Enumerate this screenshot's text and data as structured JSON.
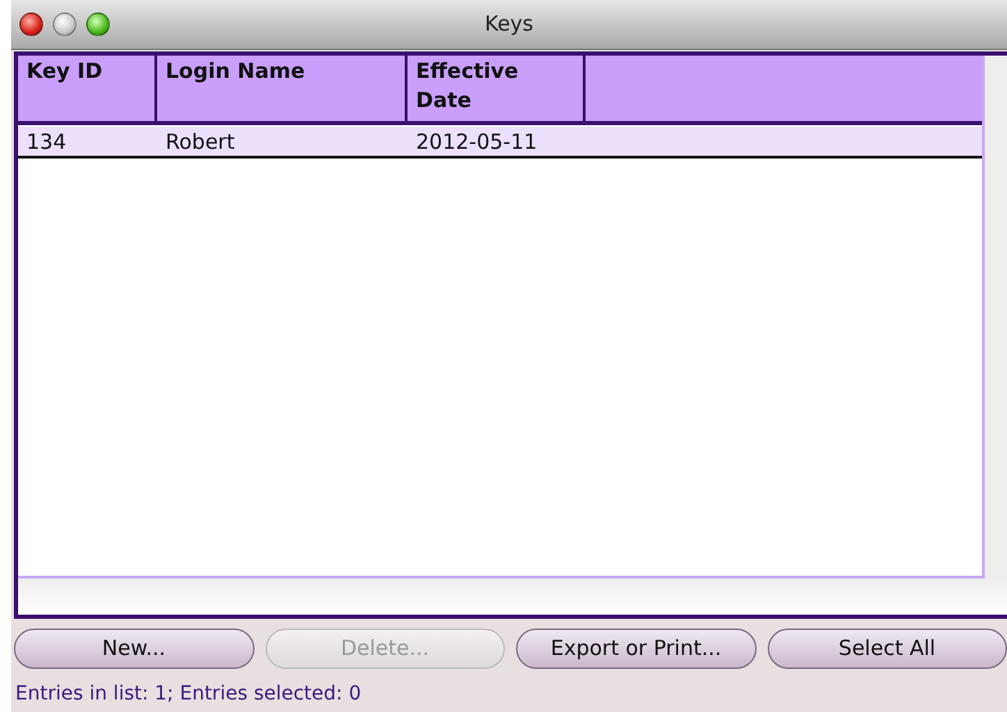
{
  "window": {
    "title": "Keys"
  },
  "title_buttons": [
    {
      "kind": "close",
      "disabled": false
    },
    {
      "kind": "minimize",
      "disabled": true
    },
    {
      "kind": "zoom",
      "disabled": false
    }
  ],
  "table": {
    "columns": [
      "Key ID",
      "Login Name",
      "Effective Date"
    ],
    "rows": [
      [
        "134",
        "Robert",
        "2012-05-11"
      ]
    ]
  },
  "buttons": [
    {
      "label": "New...",
      "disabled": false
    },
    {
      "label": "Delete...",
      "disabled": true
    },
    {
      "label": "Export or Print...",
      "disabled": false
    },
    {
      "label": "Select All",
      "disabled": false
    }
  ],
  "status_bar": "Entries in list: 1; Entries selected: 0"
}
